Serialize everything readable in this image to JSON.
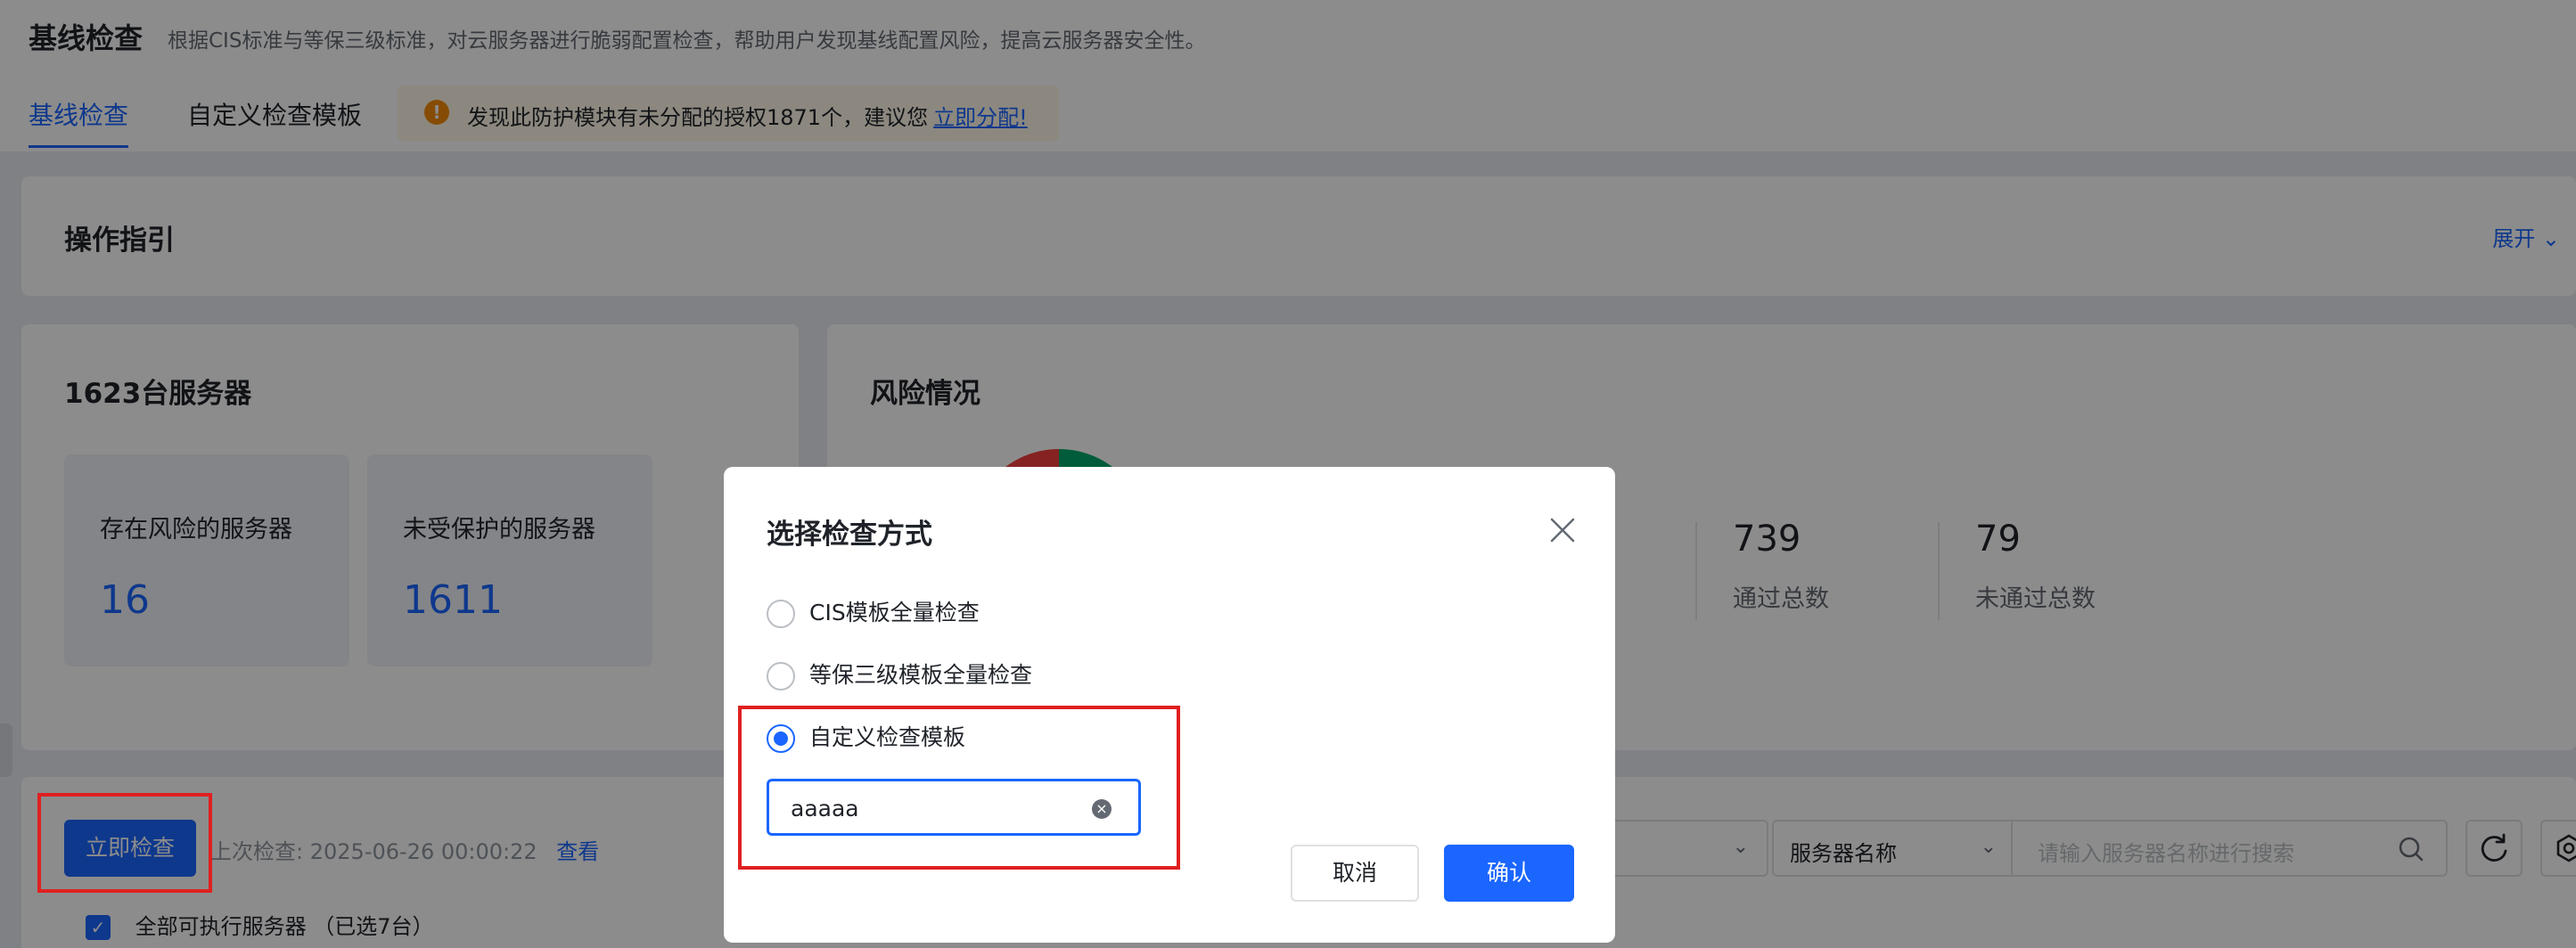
{
  "header": {
    "title": "基线检查",
    "description": "根据CIS标准与等保三级标准，对云服务器进行脆弱配置检查，帮助用户发现基线配置风险，提高云服务器安全性。",
    "tabs": [
      "基线检查",
      "自定义检查模板"
    ],
    "notice": {
      "text": "发现此防护模块有未分配的授权1871个，建议您",
      "link": "立即分配!"
    }
  },
  "guide": {
    "title": "操作指引",
    "expand_label": "展开"
  },
  "servers": {
    "title": "1623台服务器",
    "stats": [
      {
        "label": "存在风险的服务器",
        "value": "16"
      },
      {
        "label": "未受保护的服务器",
        "value": "1611"
      }
    ]
  },
  "risk": {
    "title": "风险情况",
    "metrics": [
      {
        "value": "739",
        "label": "通过总数"
      },
      {
        "value": "79",
        "label": "未通过总数"
      }
    ],
    "colors": {
      "pass": "#00a86b",
      "fail": "#f53f3f"
    }
  },
  "toolbar": {
    "scan_button": "立即检查",
    "last_check_label": "上次检查:",
    "last_check_time": "2025-06-26 00:00:22",
    "view_link": "查看",
    "select_all_label": "全部可执行服务器",
    "selected_count": "（已选7台）",
    "field_select": "服务器名称",
    "search_placeholder": "请输入服务器名称进行搜索"
  },
  "dialog": {
    "title": "选择检查方式",
    "options": [
      {
        "label": "CIS模板全量检查",
        "selected": false
      },
      {
        "label": "等保三级模板全量检查",
        "selected": false
      },
      {
        "label": "自定义检查模板",
        "selected": true
      }
    ],
    "template_value": "aaaaa",
    "cancel_label": "取消",
    "confirm_label": "确认"
  },
  "colors": {
    "accent": "#1a66ff",
    "highlight": "#e02020",
    "warning": "#f58b0a"
  }
}
